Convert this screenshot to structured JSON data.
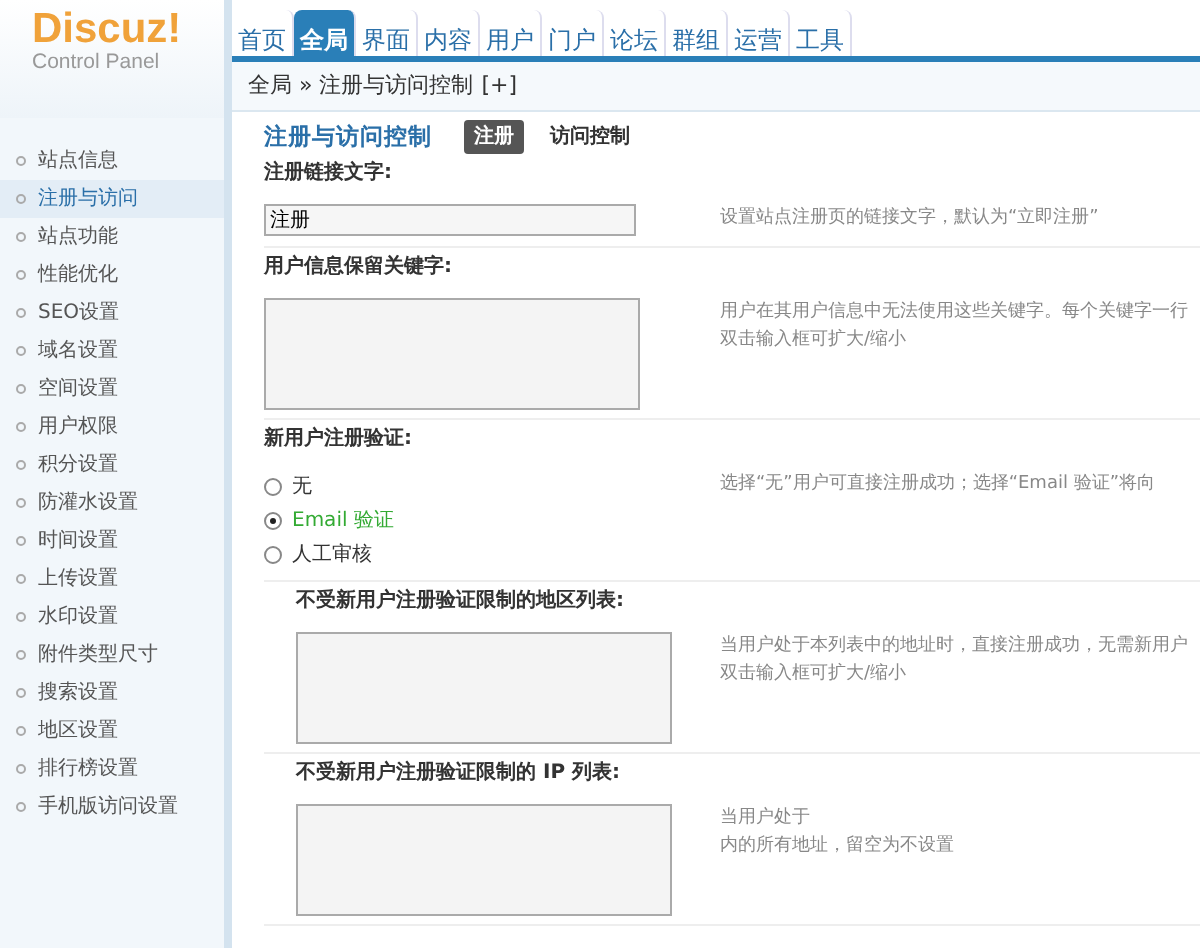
{
  "logo": {
    "title": "Discuz!",
    "subtitle": "Control Panel"
  },
  "nav": [
    {
      "label": "首页",
      "selected": false
    },
    {
      "label": "全局",
      "selected": true
    },
    {
      "label": "界面",
      "selected": false
    },
    {
      "label": "内容",
      "selected": false
    },
    {
      "label": "用户",
      "selected": false
    },
    {
      "label": "门户",
      "selected": false
    },
    {
      "label": "论坛",
      "selected": false
    },
    {
      "label": "群组",
      "selected": false
    },
    {
      "label": "运营",
      "selected": false
    },
    {
      "label": "工具",
      "selected": false
    }
  ],
  "breadcrumb": {
    "path": "全局 » 注册与访问控制",
    "toggle": "[+]"
  },
  "sidebar": {
    "items": [
      {
        "label": "站点信息",
        "selected": false
      },
      {
        "label": "注册与访问",
        "selected": true
      },
      {
        "label": "站点功能",
        "selected": false
      },
      {
        "label": "性能优化",
        "selected": false
      },
      {
        "label": "SEO设置",
        "selected": false
      },
      {
        "label": "域名设置",
        "selected": false
      },
      {
        "label": "空间设置",
        "selected": false
      },
      {
        "label": "用户权限",
        "selected": false
      },
      {
        "label": "积分设置",
        "selected": false
      },
      {
        "label": "防灌水设置",
        "selected": false
      },
      {
        "label": "时间设置",
        "selected": false
      },
      {
        "label": "上传设置",
        "selected": false
      },
      {
        "label": "水印设置",
        "selected": false
      },
      {
        "label": "附件类型尺寸",
        "selected": false
      },
      {
        "label": "搜索设置",
        "selected": false
      },
      {
        "label": "地区设置",
        "selected": false
      },
      {
        "label": "排行榜设置",
        "selected": false
      },
      {
        "label": "手机版访问设置",
        "selected": false
      }
    ]
  },
  "page": {
    "title": "注册与访问控制",
    "tabs": [
      {
        "label": "注册",
        "selected": true
      },
      {
        "label": "访问控制",
        "selected": false
      }
    ]
  },
  "settings": [
    {
      "kind": "text",
      "label": "注册链接文字:",
      "value": "注册",
      "help": [
        "设置站点注册页的链接文字，默认为“立即注册”"
      ]
    },
    {
      "kind": "textarea",
      "label": "用户信息保留关键字:",
      "help": [
        "用户在其用户信息中无法使用这些关键字。每个关键字一行",
        "双击输入框可扩大/缩小"
      ]
    },
    {
      "kind": "radio",
      "label": "新用户注册验证:",
      "options": [
        {
          "label": "无",
          "selected": false
        },
        {
          "label": "Email 验证",
          "selected": true
        },
        {
          "label": "人工审核",
          "selected": false
        }
      ],
      "help": [
        "选择“无”用户可直接注册成功；选择“Email 验证”将向"
      ]
    },
    {
      "kind": "textarea",
      "sub": true,
      "label": "不受新用户注册验证限制的地区列表:",
      "help": [
        "当用户处于本列表中的地址时，直接注册成功，无需新用户",
        "双击输入框可扩大/缩小"
      ]
    },
    {
      "kind": "textarea",
      "sub": true,
      "label": "不受新用户注册验证限制的 IP 列表:",
      "help": [
        "当用户处于",
        "内的所有地址，留空为不设置"
      ]
    }
  ]
}
